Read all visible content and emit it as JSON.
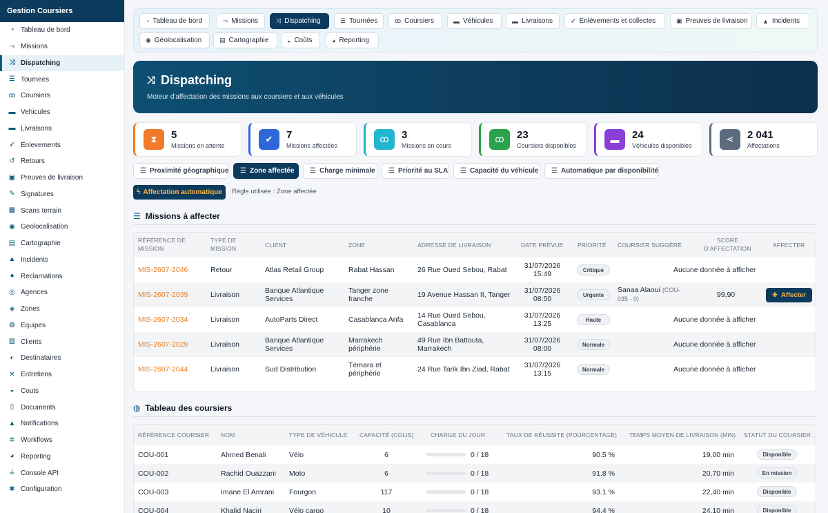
{
  "sidebar": {
    "title": "Gestion Coursiers",
    "items": [
      {
        "label": "Tableau de bord",
        "icon": "gauge-icon",
        "glyph": "◔"
      },
      {
        "label": "Missions",
        "icon": "route-icon",
        "glyph": "⤳"
      },
      {
        "label": "Dispatching",
        "icon": "shuffle-icon",
        "glyph": "⤨",
        "active": true
      },
      {
        "label": "Tournees",
        "icon": "road-icon",
        "glyph": "☰"
      },
      {
        "label": "Coursiers",
        "icon": "bicycle-icon",
        "glyph": "ꝏ"
      },
      {
        "label": "Vehicules",
        "icon": "truck-icon",
        "glyph": "▬"
      },
      {
        "label": "Livraisons",
        "icon": "shipping-icon",
        "glyph": "▬"
      },
      {
        "label": "Enlevements",
        "icon": "plane-icon",
        "glyph": "➶"
      },
      {
        "label": "Retours",
        "icon": "undo-icon",
        "glyph": "↺"
      },
      {
        "label": "Preuves de livraison",
        "icon": "clipboard-check-icon",
        "glyph": "▣"
      },
      {
        "label": "Signatures",
        "icon": "signature-icon",
        "glyph": "✎"
      },
      {
        "label": "Scans terrain",
        "icon": "barcode-icon",
        "glyph": "▦"
      },
      {
        "label": "Geolocalisation",
        "icon": "satellite-icon",
        "glyph": "◉"
      },
      {
        "label": "Cartographie",
        "icon": "map-icon",
        "glyph": "▤"
      },
      {
        "label": "Incidents",
        "icon": "warning-icon",
        "glyph": "▲"
      },
      {
        "label": "Reclamations",
        "icon": "comment-icon",
        "glyph": "●"
      },
      {
        "label": "Agences",
        "icon": "globe-icon",
        "glyph": "◎"
      },
      {
        "label": "Zones",
        "icon": "location-icon",
        "glyph": "◈"
      },
      {
        "label": "Equipes",
        "icon": "users-icon",
        "glyph": "◍"
      },
      {
        "label": "Clients",
        "icon": "building-icon",
        "glyph": "▥"
      },
      {
        "label": "Destinataires",
        "icon": "user-tag-icon",
        "glyph": "◐"
      },
      {
        "label": "Entretiens",
        "icon": "tools-icon",
        "glyph": "✕"
      },
      {
        "label": "Couts",
        "icon": "coins-icon",
        "glyph": "◒"
      },
      {
        "label": "Documents",
        "icon": "document-icon",
        "glyph": "▯"
      },
      {
        "label": "Notifications",
        "icon": "bell-icon",
        "glyph": "▲"
      },
      {
        "label": "Workflows",
        "icon": "cogs-icon",
        "glyph": "✲"
      },
      {
        "label": "Reporting",
        "icon": "pie-chart-icon",
        "glyph": "◕"
      },
      {
        "label": "Console API",
        "icon": "plug-icon",
        "glyph": "⏚"
      },
      {
        "label": "Configuration",
        "icon": "gear-icon",
        "glyph": "✱"
      }
    ]
  },
  "tabs": [
    {
      "label": "Tableau de bord",
      "icon": "gauge-icon",
      "glyph": "◔"
    },
    {
      "label": "Missions",
      "icon": "route-icon",
      "glyph": "⤳"
    },
    {
      "label": "Dispatching",
      "icon": "shuffle-icon",
      "glyph": "⤨",
      "active": true
    },
    {
      "label": "Tournées",
      "icon": "road-icon",
      "glyph": "☰"
    },
    {
      "label": "Coursiers",
      "icon": "bicycle-icon",
      "glyph": "ꝏ"
    },
    {
      "label": "Véhicules",
      "icon": "truck-icon",
      "glyph": "▬"
    },
    {
      "label": "Livraisons",
      "icon": "shipping-icon",
      "glyph": "▬"
    },
    {
      "label": "Enlèvements et collectes",
      "icon": "plane-icon",
      "glyph": "➶"
    },
    {
      "label": "Preuves de livraison",
      "icon": "clipboard-check-icon",
      "glyph": "▣"
    },
    {
      "label": "Incidents",
      "icon": "warning-icon",
      "glyph": "▲"
    },
    {
      "label": "Géolocalisation",
      "icon": "satellite-icon",
      "glyph": "◉"
    },
    {
      "label": "Cartographie",
      "icon": "map-icon",
      "glyph": "▤"
    },
    {
      "label": "Coûts",
      "icon": "coins-icon",
      "glyph": "◒"
    },
    {
      "label": "Reporting",
      "icon": "pie-chart-icon",
      "glyph": "◕"
    }
  ],
  "hero": {
    "title": "Dispatching",
    "subtitle": "Moteur d'affectation des missions aux coursiers et aux véhicules"
  },
  "stats": [
    {
      "value": "5",
      "label": "Missions en attente",
      "icon": "hourglass-icon",
      "glyph": "⧗",
      "color": "#f07a2a",
      "accent": "#f07a2a"
    },
    {
      "value": "7",
      "label": "Missions affectées",
      "icon": "user-check-icon",
      "glyph": "✔",
      "color": "#2f66d8",
      "accent": "#2f66d8"
    },
    {
      "value": "3",
      "label": "Missions en cours",
      "icon": "bicycle-icon",
      "glyph": "ꝏ",
      "color": "#22b5cf",
      "accent": "#22b5cf"
    },
    {
      "value": "23",
      "label": "Coursiers disponibles",
      "icon": "bicycle-icon",
      "glyph": "ꝏ",
      "color": "#2ba24c",
      "accent": "#2ba24c"
    },
    {
      "value": "24",
      "label": "Véhicules disponibles",
      "icon": "truck-icon",
      "glyph": "▬",
      "color": "#8a3fd8",
      "accent": "#8a3fd8"
    },
    {
      "value": "2 041",
      "label": "Affectations",
      "icon": "share-icon",
      "glyph": "⋖",
      "color": "#5d6b7e",
      "accent": "#5d6b7e"
    }
  ],
  "rules": [
    {
      "label": "Proximité géographique"
    },
    {
      "label": "Zone affectée",
      "active": true
    },
    {
      "label": "Charge minimale"
    },
    {
      "label": "Priorité au SLA"
    },
    {
      "label": "Capacité du véhicule"
    },
    {
      "label": "Automatique par disponibilité"
    }
  ],
  "auto_button": "Affectation automatique",
  "rule_used": "Règle utilisée : Zone affectée",
  "missions": {
    "title": "Missions à affecter",
    "columns": [
      "RÉFÉRENCE DE MISSION",
      "TYPE DE MISSION",
      "CLIENT",
      "ZONE",
      "ADRESSE DE LIVRAISON",
      "DATE PRÉVUE",
      "PRIORITÉ",
      "COURSIER SUGGÉRÉ",
      "SCORE D'AFFECTATION",
      "AFFECTER"
    ],
    "rows": [
      {
        "ref": "MIS-2607-2046",
        "type": "Retour",
        "client": "Atlas Retail Group",
        "zone": "Rabat Hassan",
        "address": "26 Rue Oued Sebou, Rabat",
        "date": "31/07/2026 15:49",
        "priority": "Critique",
        "empty": "Aucune donnée à afficher"
      },
      {
        "ref": "MIS-2607-2039",
        "type": "Livraison",
        "client": "Banque Atlantique Services",
        "zone": "Tanger zone franche",
        "address": "19 Avenue Hassan II, Tanger",
        "date": "31/07/2026 08:50",
        "priority": "Urgente",
        "courier": "Sanaa Alaoui",
        "courier_ref": "(COU-035 · 0)",
        "score": "99,90",
        "assign": "Affecter"
      },
      {
        "ref": "MIS-2607-2034",
        "type": "Livraison",
        "client": "AutoParts Direct",
        "zone": "Casablanca Anfa",
        "address": "14 Rue Oued Sebou, Casablanca",
        "date": "31/07/2026 13:25",
        "priority": "Haute",
        "empty": "Aucune donnée à afficher"
      },
      {
        "ref": "MIS-2607-2029",
        "type": "Livraison",
        "client": "Banque Atlantique Services",
        "zone": "Marrakech périphérie",
        "address": "49 Rue Ibn Battouta, Marrakech",
        "date": "31/07/2026 08:00",
        "priority": "Normale",
        "empty": "Aucune donnée à afficher"
      },
      {
        "ref": "MIS-2607-2044",
        "type": "Livraison",
        "client": "Sud Distribution",
        "zone": "Témara et périphérie",
        "address": "24 Rue Tarik Ibn Ziad, Rabat",
        "date": "31/07/2026 13:15",
        "priority": "Normale",
        "empty": "Aucune donnée à afficher"
      }
    ]
  },
  "couriers": {
    "title": "Tableau des coursiers",
    "columns": [
      "RÉFÉRENCE COURSIER",
      "NOM",
      "TYPE DE VÉHICULE",
      "CAPACITÉ (COLIS)",
      "CHARGE DU JOUR",
      "TAUX DE RÉUSSITE (POURCENTAGE)",
      "TEMPS MOYEN DE LIVRAISON (MIN)",
      "STATUT DU COURSIER"
    ],
    "rows": [
      {
        "ref": "COU-001",
        "name": "Ahmed Benali",
        "vehicle": "Vélo",
        "capacity": "6",
        "load": "0 / 18",
        "load_fraction": 0,
        "rate": "90.5 %",
        "time": "19,00 min",
        "status": "Disponible"
      },
      {
        "ref": "COU-002",
        "name": "Rachid Ouazzani",
        "vehicle": "Moto",
        "capacity": "6",
        "load": "0 / 18",
        "load_fraction": 0,
        "rate": "91.8 %",
        "time": "20,70 min",
        "status": "En mission"
      },
      {
        "ref": "COU-003",
        "name": "Imane El Amrani",
        "vehicle": "Fourgon",
        "capacity": "117",
        "load": "0 / 18",
        "load_fraction": 0,
        "rate": "93.1 %",
        "time": "22,40 min",
        "status": "Disponible"
      },
      {
        "ref": "COU-004",
        "name": "Khalid Naciri",
        "vehicle": "Vélo cargo",
        "capacity": "10",
        "load": "0 / 18",
        "load_fraction": 0,
        "rate": "94.4 %",
        "time": "24,10 min",
        "status": "Disponible"
      }
    ]
  }
}
